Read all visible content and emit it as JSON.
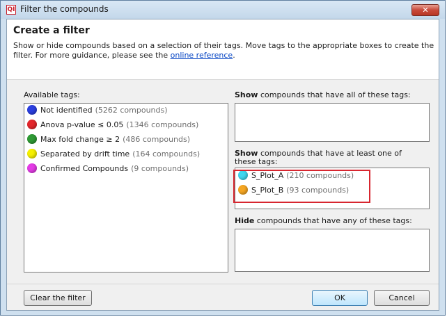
{
  "window": {
    "title": "Filter the compounds",
    "app_icon_text": "QI",
    "close_glyph": "✕"
  },
  "header": {
    "title": "Create a filter",
    "description": "Show or hide compounds based on a selection of their tags. Move tags to the appropriate boxes to create the filter. For more guidance, please see the ",
    "link_text": "online reference",
    "description_end": "."
  },
  "available": {
    "label": "Available tags:",
    "tags": [
      {
        "name": "Not identified",
        "count": "(5262 compounds)",
        "color": "#2b3fe0"
      },
      {
        "name": "Anova p-value ≤ 0.05",
        "count": "(1346 compounds)",
        "color": "#e3262b"
      },
      {
        "name": "Max fold change ≥ 2",
        "count": "(486 compounds)",
        "color": "#2f9a35"
      },
      {
        "name": "Separated by drift time",
        "count": "(164 compounds)",
        "color": "#f5f000"
      },
      {
        "name": "Confirmed Compounds",
        "count": "(9 compounds)",
        "color": "#e43be6"
      }
    ]
  },
  "show_all": {
    "label_bold": "Show",
    "label_rest": " compounds that have all of these tags:"
  },
  "show_any": {
    "label_bold": "Show",
    "label_rest": " compounds that have at least one of",
    "label_line2": "these tags:",
    "tags": [
      {
        "name": "S_Plot_A",
        "count": "(210 compounds)",
        "color": "#3fd6ef"
      },
      {
        "name": "S_Plot_B",
        "count": "(93 compounds)",
        "color": "#f5a623"
      }
    ]
  },
  "hide": {
    "label_bold": "Hide",
    "label_rest": " compounds that have any of these tags:"
  },
  "buttons": {
    "clear": "Clear the filter",
    "ok": "OK",
    "cancel": "Cancel"
  }
}
